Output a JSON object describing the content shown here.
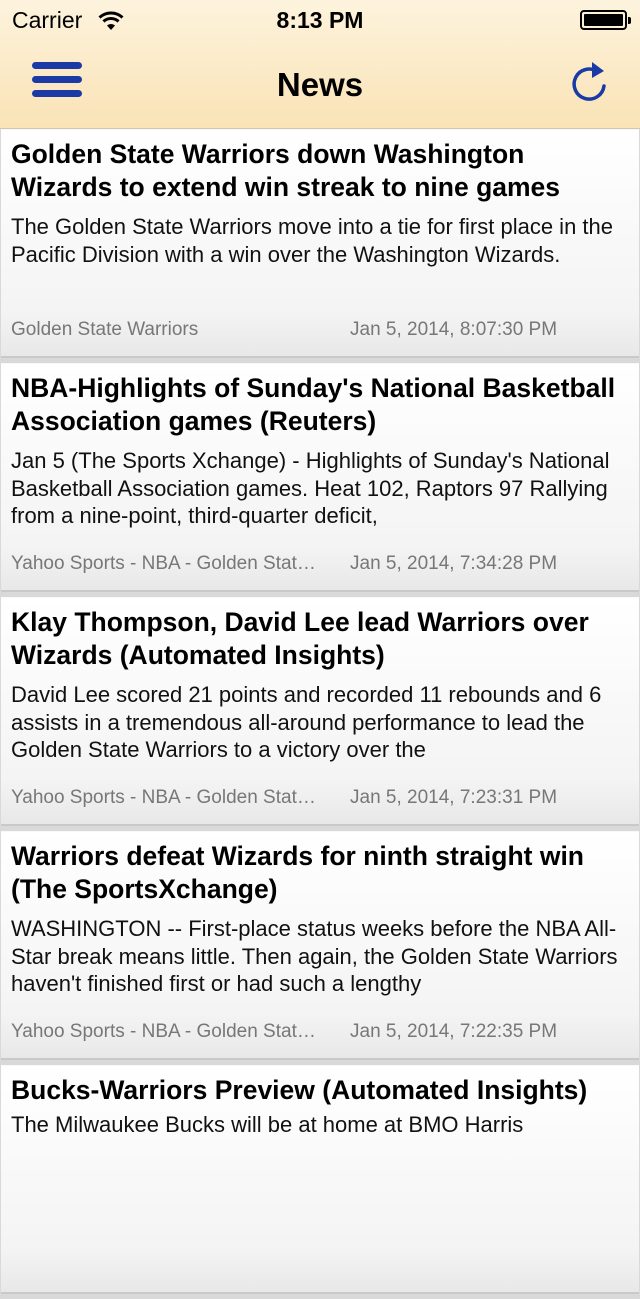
{
  "status_bar": {
    "carrier": "Carrier",
    "time": "8:13 PM"
  },
  "nav": {
    "title": "News",
    "left_icon": "menu-icon",
    "right_icon": "refresh-icon",
    "accent_color": "#1a3aa5"
  },
  "articles": [
    {
      "title": "Golden State Warriors down Washington Wizards to extend win streak to nine games",
      "summary": "The Golden State Warriors move into a tie for first place in the Pacific Division with a win over the Washington Wizards.",
      "source": "Golden State Warriors",
      "date": "Jan 5, 2014, 8:07:30 PM"
    },
    {
      "title": "NBA-Highlights of Sunday's National Basketball Association games (Reuters)",
      "summary": "Jan 5 (The Sports Xchange) - Highlights of Sunday's National Basketball Association games. Heat 102, Raptors 97 Rallying from a nine-point, third-quarter deficit,",
      "source": "Yahoo Sports - NBA - Golden Stat…",
      "date": "Jan 5, 2014, 7:34:28 PM"
    },
    {
      "title": "Klay Thompson, David Lee lead Warriors over Wizards (Automated Insights)",
      "summary": "David Lee scored 21 points and recorded 11 rebounds and 6 assists in a tremendous all-around performance to lead the Golden State Warriors to a victory over the",
      "source": "Yahoo Sports - NBA - Golden Stat…",
      "date": "Jan 5, 2014, 7:23:31 PM"
    },
    {
      "title": "Warriors defeat Wizards for ninth straight win (The SportsXchange)",
      "summary": "WASHINGTON -- First-place status weeks before the NBA All-Star break means little.  Then again, the Golden State Warriors haven't finished first or had such a lengthy",
      "source": "Yahoo Sports - NBA - Golden Stat…",
      "date": "Jan 5, 2014, 7:22:35 PM"
    },
    {
      "title": "Bucks-Warriors Preview (Automated Insights)",
      "summary": "The Milwaukee Bucks will be at home at BMO Harris",
      "source": "",
      "date": ""
    }
  ]
}
